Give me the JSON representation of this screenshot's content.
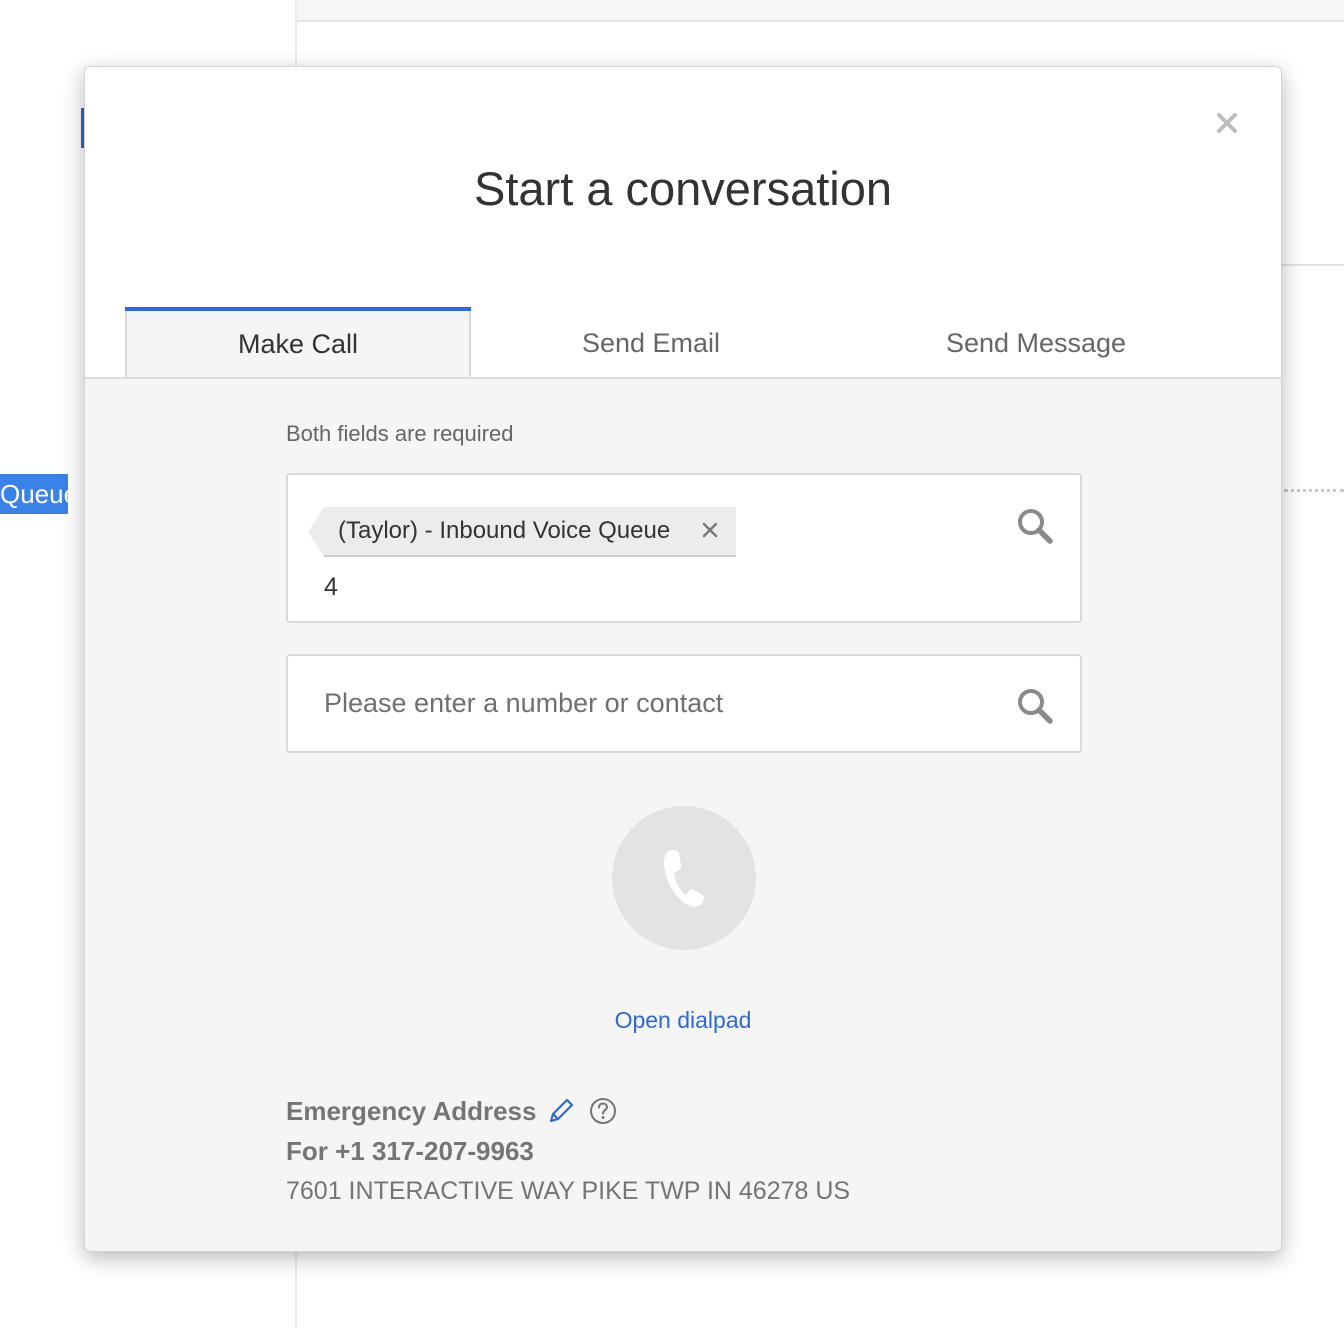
{
  "background": {
    "highlighted_text": "Queue"
  },
  "modal": {
    "title": "Start a conversation",
    "close_icon": "close-icon",
    "tabs": [
      {
        "label": "Make Call",
        "active": true
      },
      {
        "label": "Send Email",
        "active": false
      },
      {
        "label": "Send Message",
        "active": false
      }
    ],
    "hint": "Both fields are required",
    "queue_field": {
      "tag_label": "(Taylor) - Inbound Voice Queue",
      "value": "4",
      "icon": "search-icon"
    },
    "contact_field": {
      "placeholder": "Please enter a number or contact",
      "value": "",
      "icon": "search-icon"
    },
    "call_button_icon": "phone-icon",
    "dialpad_link": "Open dialpad",
    "emergency": {
      "title": "Emergency Address",
      "phone_line": "For +1 317-207-9963",
      "address": "7601 INTERACTIVE WAY PIKE TWP IN 46278 US"
    }
  },
  "colors": {
    "accent": "#2f6ad0",
    "modal_body": "#f5f5f5",
    "muted_text": "#757575"
  }
}
